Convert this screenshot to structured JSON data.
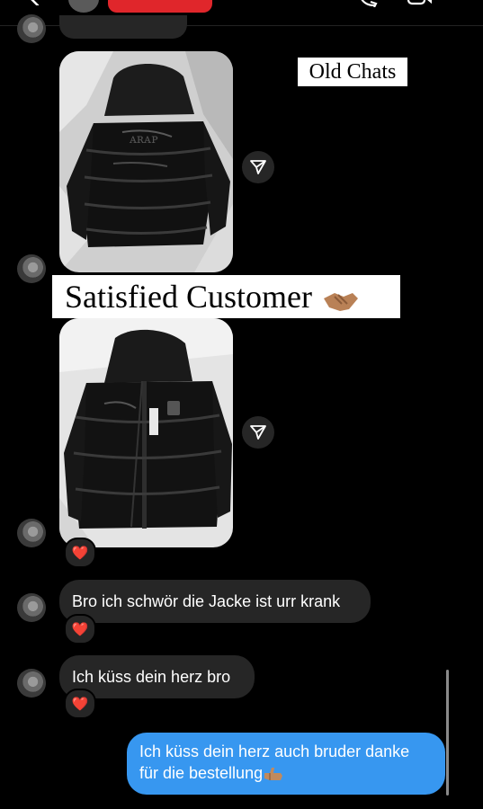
{
  "header": {
    "back_icon": "chevron-left-icon",
    "call_icon": "phone-icon",
    "video_icon": "video-camera-icon",
    "accent": "#e0262b"
  },
  "captions": {
    "old_chats": "Old Chats",
    "satisfied": "Satisfied Customer"
  },
  "messages": {
    "received_1": "Bro ich schwör die Jacke ist urr krank",
    "received_2": "Ich küss dein herz bro",
    "sent_line1": "Ich küss dein herz auch bruder danke",
    "sent_line2": "für die bestellung"
  },
  "reactions": {
    "heart": "❤️"
  },
  "icons": {
    "share": "paper-plane-icon",
    "handshake": "handshake-emoji",
    "thumbs": "thumbs-up-emoji"
  },
  "colors": {
    "received_bubble": "#262626",
    "sent_bubble": "#3797f0",
    "background": "#000000"
  }
}
